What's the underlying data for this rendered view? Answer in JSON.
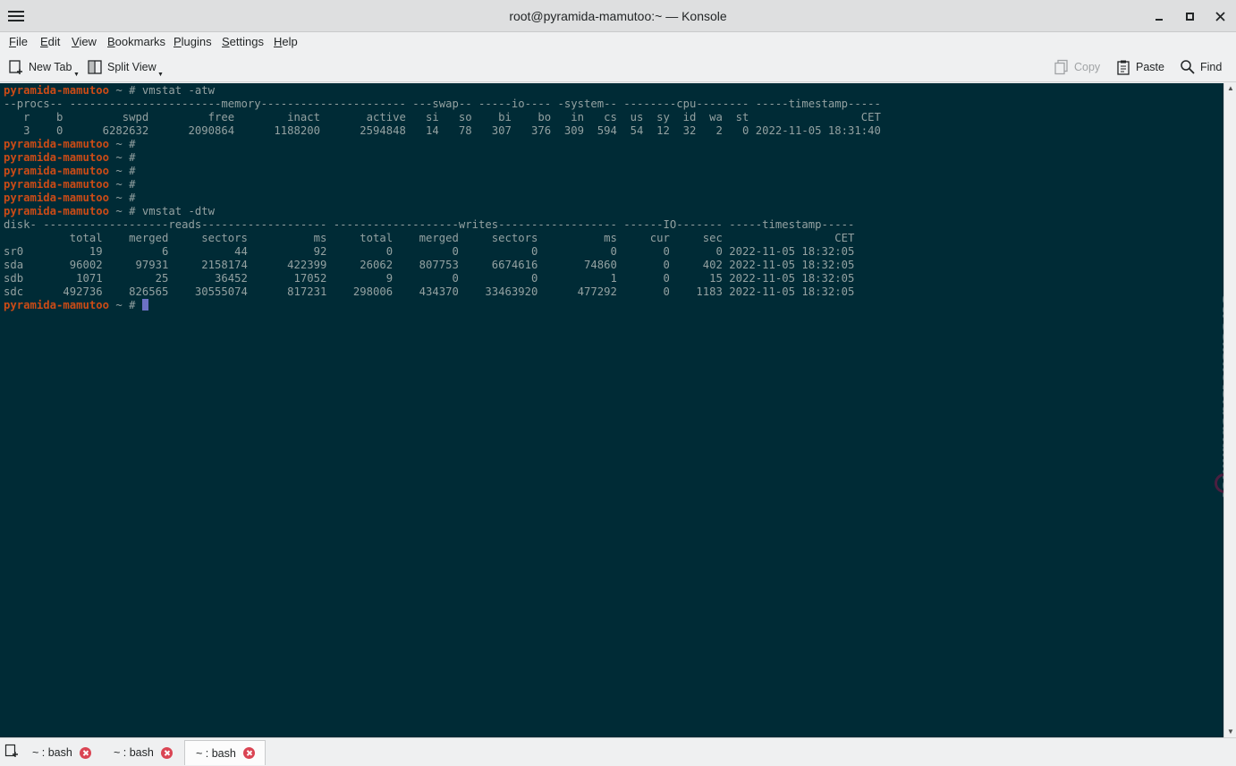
{
  "window": {
    "title": "root@pyramida-mamutoo:~ — Konsole"
  },
  "menu": [
    {
      "label": "File",
      "mnemonic": "F",
      "rest": "ile"
    },
    {
      "label": "Edit",
      "mnemonic": "E",
      "rest": "dit"
    },
    {
      "label": "View",
      "mnemonic": "V",
      "rest": "iew"
    },
    {
      "label": "Bookmarks",
      "mnemonic": "B",
      "rest": "ookmarks"
    },
    {
      "label": "Plugins",
      "mnemonic": "P",
      "rest": "lugins"
    },
    {
      "label": "Settings",
      "mnemonic": "S",
      "rest": "ettings"
    },
    {
      "label": "Help",
      "mnemonic": "H",
      "rest": "elp"
    }
  ],
  "toolbar": {
    "new_tab": "New Tab",
    "split_view": "Split View",
    "copy": "Copy",
    "paste": "Paste",
    "find": "Find"
  },
  "terminal": {
    "prompt": "pyramida-mamutoo",
    "prompt_suffix": " ~ # ",
    "cmd1": "vmstat -atw",
    "vm_hdr1": "--procs-- -----------------------memory---------------------- ---swap-- -----io---- -system-- --------cpu-------- -----timestamp-----",
    "vm_hdr2": "   r    b         swpd         free        inact       active   si   so    bi    bo   in   cs  us  sy  id  wa  st                 CET",
    "vm_row1": "   3    0      6282632      2090864      1188200      2594848   14   78   307   376  309  594  54  12  32   2   0 2022-11-05 18:31:40",
    "cmd2": "vmstat -dtw",
    "disk_hdr1": "disk- -------------------reads------------------- -------------------writes------------------ ------IO------- -----timestamp-----",
    "disk_hdr2": "          total    merged     sectors          ms     total    merged     sectors          ms     cur     sec                 CET",
    "disk_rows": [
      "sr0          19         6          44          92         0         0           0           0       0       0 2022-11-05 18:32:05",
      "sda       96002     97931     2158174      422399     26062    807753     6674616       74860       0     402 2022-11-05 18:32:05",
      "sdb        1071        25       36452       17052         9         0           0           1       0      15 2022-11-05 18:32:05",
      "sdc      492736    826565    30555074      817231    298006    434370    33463920      477292       0    1183 2022-11-05 18:32:05"
    ],
    "colors": {
      "background": "#002b36",
      "foreground": "#93a1a1",
      "prompt": "#cb4b16",
      "cursor": "#6c71c4"
    }
  },
  "watermark": "screenshots.debian.net",
  "tabs": [
    {
      "label": "~ : bash",
      "active": false
    },
    {
      "label": "~ : bash",
      "active": false
    },
    {
      "label": "~ : bash",
      "active": true
    }
  ],
  "icons": [
    "menu-icon",
    "minimize-icon",
    "maximize-icon",
    "close-icon",
    "new-tab-icon",
    "split-view-icon",
    "copy-icon",
    "paste-icon",
    "find-icon",
    "close-tab-icon"
  ]
}
